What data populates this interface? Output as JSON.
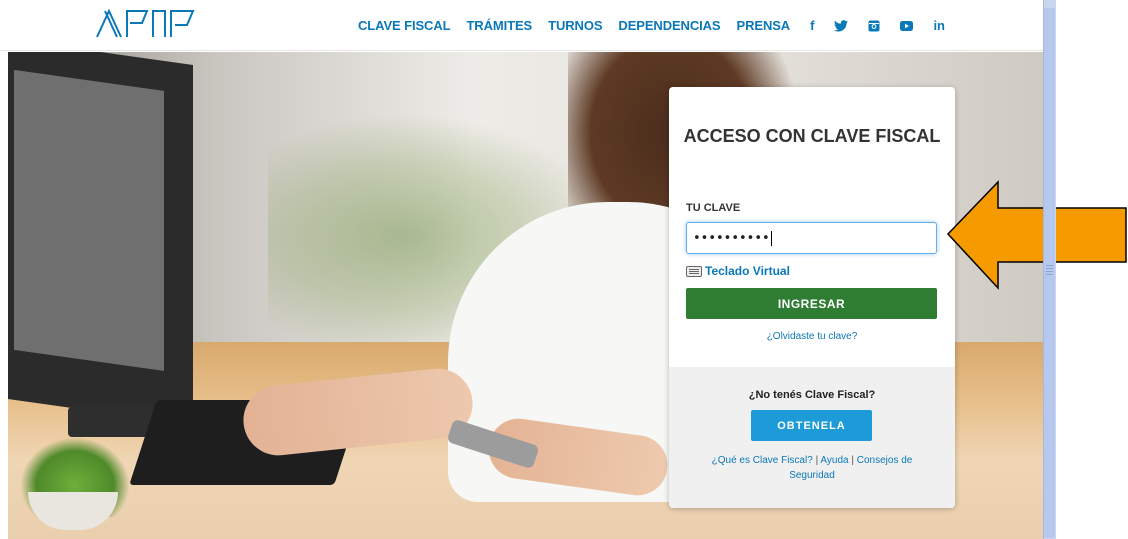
{
  "header": {
    "logo_text": "AFIP",
    "nav": [
      "CLAVE FISCAL",
      "TRÁMITES",
      "TURNOS",
      "DEPENDENCIAS",
      "PRENSA"
    ],
    "social": {
      "facebook": "f",
      "twitter": "twitter-icon",
      "instagram": "instagram-icon",
      "youtube": "youtube-icon",
      "linkedin": "in"
    }
  },
  "login": {
    "title": "ACCESO CON CLAVE FISCAL",
    "field_label": "TU CLAVE",
    "password_value": "••••••••••",
    "virtual_keyboard": "Teclado Virtual",
    "submit": "INGRESAR",
    "forgot": "¿Olvidaste tu clave?"
  },
  "signup": {
    "prompt": "¿No tenés Clave Fiscal?",
    "button": "OBTENELA",
    "link_what": "¿Qué es Clave Fiscal?",
    "link_help": "Ayuda",
    "link_security": "Consejos de Seguridad",
    "separator": "|"
  },
  "colors": {
    "nav_link": "#0b78b8",
    "primary_green": "#2e7d32",
    "obtenela_blue": "#1d9bd8",
    "arrow_orange": "#f59b00"
  }
}
